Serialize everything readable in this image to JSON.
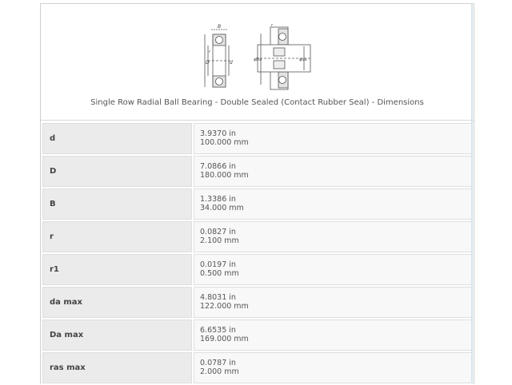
{
  "header": {
    "caption": "Single Row Radial Ball Bearing - Double Sealed (Contact Rubber Seal) - Dimensions",
    "diagram": {
      "label_B": "B",
      "label_r_left": "r",
      "label_D": "D",
      "label_d": "d",
      "label_r_right": "r",
      "label_Da": "φDa",
      "label_da": "φda",
      "icon": "bearing-dimension-diagram"
    }
  },
  "rows": [
    {
      "name": "d",
      "in": "3.9370 in",
      "mm": "100.000 mm"
    },
    {
      "name": "D",
      "in": "7.0866 in",
      "mm": "180.000 mm"
    },
    {
      "name": "B",
      "in": "1.3386 in",
      "mm": "34.000 mm"
    },
    {
      "name": "r",
      "in": "0.0827 in",
      "mm": "2.100 mm"
    },
    {
      "name": "r1",
      "in": "0.0197 in",
      "mm": "0.500 mm"
    },
    {
      "name": "da max",
      "in": "4.8031 in",
      "mm": "122.000 mm"
    },
    {
      "name": "Da max",
      "in": "6.6535 in",
      "mm": "169.000 mm"
    },
    {
      "name": "ras max",
      "in": "0.0787 in",
      "mm": "2.000 mm"
    }
  ]
}
